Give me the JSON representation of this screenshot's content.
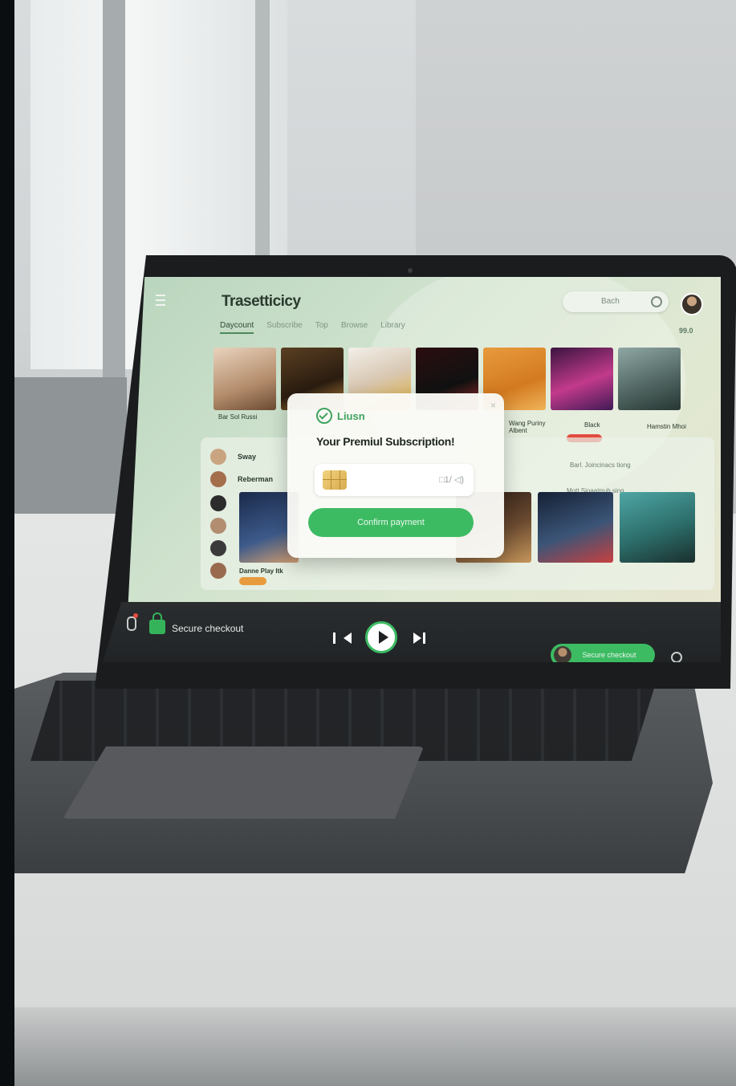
{
  "app": {
    "title": "Trasetticicy",
    "tabs": [
      "Daycount",
      "Subscribe",
      "Top",
      "Browse",
      "Library"
    ],
    "search_text": "Bach",
    "corner_label": "99.0"
  },
  "albums": {
    "captions": [
      "Bar Sol Russi",
      "Wang Puriny\nAlbent",
      "Black",
      "Hamstin Mhoi"
    ]
  },
  "list": {
    "rows": [
      "Sway",
      "Reberman"
    ],
    "right_rows": [
      "Barl. Joincinacs tiong",
      "Mott Sioaatrruh sing"
    ],
    "caption": "Danne Play Itk"
  },
  "modal": {
    "brand": "Liusn",
    "heading": "Your Premiul Subscription!",
    "card_meta": "□1/ ◁)",
    "confirm_label": "Confirm payment"
  },
  "player": {
    "secure_label": "Secure checkout",
    "checkout_label": "Secure checkout"
  },
  "colors": {
    "accent": "#3dbb63",
    "screen_bg": "#cfe2cd",
    "player_bg": "#2a2d2f"
  }
}
